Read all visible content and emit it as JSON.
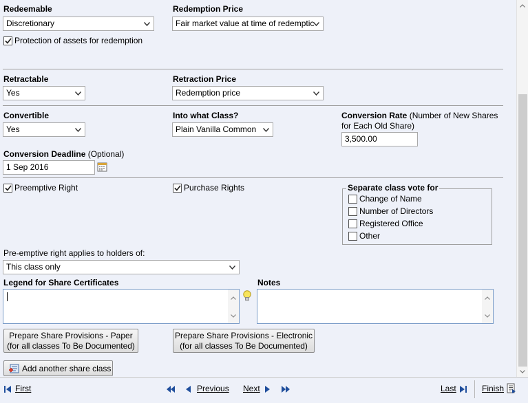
{
  "redeemable": {
    "label": "Redeemable",
    "value": "Discretionary"
  },
  "redemption_price": {
    "label": "Redemption Price",
    "value": "Fair market value at time of redemptic"
  },
  "protection": {
    "label": "Protection of assets for redemption",
    "checked": true
  },
  "retractable": {
    "label": "Retractable",
    "value": "Yes"
  },
  "retraction_price": {
    "label": "Retraction Price",
    "value": "Redemption price"
  },
  "convertible": {
    "label": "Convertible",
    "value": "Yes"
  },
  "into_class": {
    "label": "Into what Class?",
    "value": "Plain Vanilla Common"
  },
  "conversion_rate": {
    "label": "Conversion Rate",
    "label_note": " (Number of New Shares for Each Old Share)",
    "value": "3,500.00"
  },
  "conversion_deadline": {
    "label": "Conversion Deadline",
    "label_note": " (Optional)",
    "value": "1 Sep 2016"
  },
  "preemptive_right": {
    "label": "Preemptive Right",
    "checked": true
  },
  "purchase_rights": {
    "label": "Purchase Rights",
    "checked": true
  },
  "separate_vote": {
    "title": "Separate class vote for",
    "options": [
      {
        "label": "Change of Name",
        "checked": false
      },
      {
        "label": "Number of Directors",
        "checked": false
      },
      {
        "label": "Registered Office",
        "checked": false
      },
      {
        "label": "Other",
        "checked": false
      }
    ]
  },
  "preemptive_applies": {
    "label": "Pre-emptive right applies to holders of:",
    "value": "This class only"
  },
  "legend": {
    "label": "Legend for Share Certificates",
    "value": ""
  },
  "notes": {
    "label": "Notes",
    "value": ""
  },
  "buttons": {
    "paper_line1": "Prepare Share Provisions - Paper",
    "paper_line2": "(for all classes To Be Documented)",
    "electronic_line1": "Prepare Share Provisions - Electronic",
    "electronic_line2": "(for all classes To Be Documented)",
    "add_class": "Add another share class"
  },
  "nav": {
    "first": "First",
    "previous": "Previous",
    "next": "Next",
    "last": "Last",
    "finish": "Finish"
  },
  "colors": {
    "background": "#eef1f9",
    "nav_arrow": "#1f4e9c"
  }
}
